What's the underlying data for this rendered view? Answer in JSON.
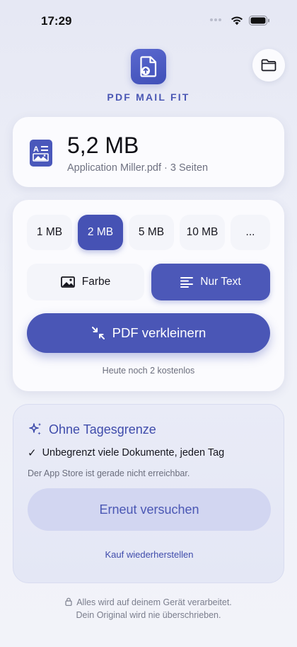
{
  "status_bar": {
    "time": "17:29"
  },
  "header": {
    "app_title": "PDF MAIL FIT"
  },
  "file": {
    "size": "5,2 MB",
    "meta": "Application Miller.pdf · 3 Seiten"
  },
  "size_options": [
    {
      "label": "1 MB",
      "selected": false
    },
    {
      "label": "2 MB",
      "selected": true
    },
    {
      "label": "5 MB",
      "selected": false
    },
    {
      "label": "10 MB",
      "selected": false
    },
    {
      "label": "...",
      "selected": false
    }
  ],
  "modes": {
    "color_label": "Farbe",
    "text_label": "Nur Text",
    "selected": "Nur Text"
  },
  "compress": {
    "button_label": "PDF verkleinern",
    "free_count": "Heute noch 2 kostenlos"
  },
  "premium": {
    "title": "Ohne Tagesgrenze",
    "feature": "Unbegrenzt viele Dokumente, jeden Tag",
    "store_note": "Der App Store ist gerade nicht erreichbar.",
    "retry_label": "Erneut versuchen",
    "restore_label": "Kauf wiederherstellen"
  },
  "footer": {
    "line1": "Alles wird auf deinem Gerät verarbeitet.",
    "line2": "Dein Original wird nie überschrieben."
  },
  "icons": {
    "app_logo": "pdf-upload-icon",
    "folder": "folder-icon",
    "file": "pdf-document-icon",
    "color_mode": "image-icon",
    "text_mode": "text-lines-icon",
    "compress": "arrows-in-icon",
    "premium": "sparkles-icon",
    "check": "checkmark-icon",
    "footer": "lock-icon"
  },
  "colors": {
    "accent": "#4a56b6",
    "accent_text": "#4a57b4",
    "retry_bg": "#d2d6f1"
  }
}
